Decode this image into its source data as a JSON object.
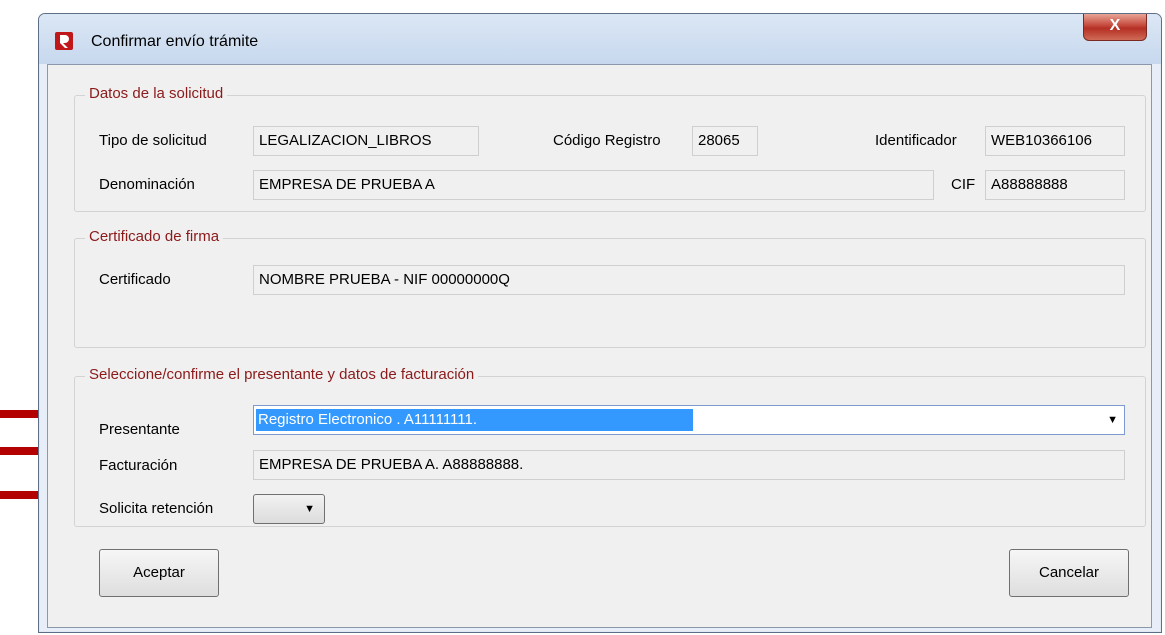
{
  "window": {
    "title": "Confirmar envío trámite",
    "close_symbol": "X"
  },
  "solicitud": {
    "legend": "Datos de la solicitud",
    "tipo_label": "Tipo de solicitud",
    "tipo_value": "LEGALIZACION_LIBROS",
    "codigo_label": "Código Registro",
    "codigo_value": "28065",
    "identificador_label": "Identificador",
    "identificador_value": "WEB10366106",
    "denominacion_label": "Denominación",
    "denominacion_value": "EMPRESA DE PRUEBA A",
    "cif_label": "CIF",
    "cif_value": "A88888888"
  },
  "certificado": {
    "legend": "Certificado de firma",
    "label": "Certificado",
    "value": "NOMBRE PRUEBA  - NIF 00000000Q"
  },
  "presentante": {
    "legend": "Seleccione/confirme el presentante y datos de facturación",
    "presentante_label": "Presentante",
    "presentante_value": "Registro Electronico . A11111111.",
    "facturacion_label": "Facturación",
    "facturacion_value": "EMPRESA DE PRUEBA A. A88888888.",
    "retencion_label": "Solicita retención",
    "retencion_value": ""
  },
  "buttons": {
    "accept": "Aceptar",
    "cancel": "Cancelar"
  },
  "colors": {
    "legend": "#8b1a1a",
    "arrow": "#b30000",
    "selection": "#3399ff"
  }
}
